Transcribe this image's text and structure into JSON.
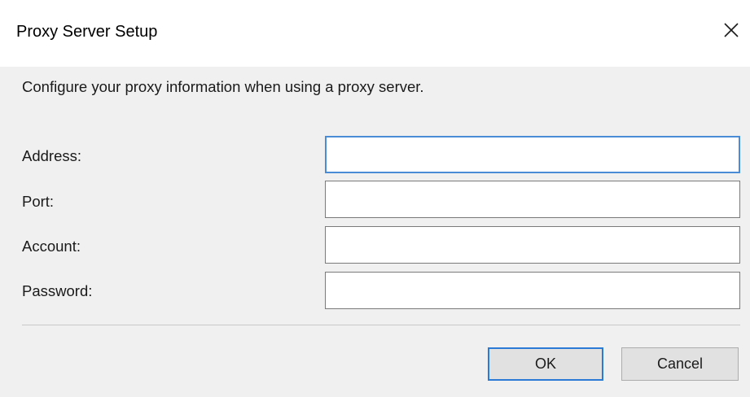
{
  "window": {
    "title": "Proxy Server Setup",
    "close_icon": "close-icon"
  },
  "dialog": {
    "description": "Configure your proxy information when using a proxy server.",
    "fields": [
      {
        "label": "Address:",
        "value": ""
      },
      {
        "label": "Port:",
        "value": ""
      },
      {
        "label": "Account:",
        "value": ""
      },
      {
        "label": "Password:",
        "value": ""
      }
    ],
    "ok_label": "OK",
    "cancel_label": "Cancel"
  },
  "colors": {
    "focus_border": "#4a8cd6",
    "default_button_border": "#2b7bd6",
    "dialog_background": "#f0f0f0",
    "titlebar_background": "#ffffff"
  }
}
